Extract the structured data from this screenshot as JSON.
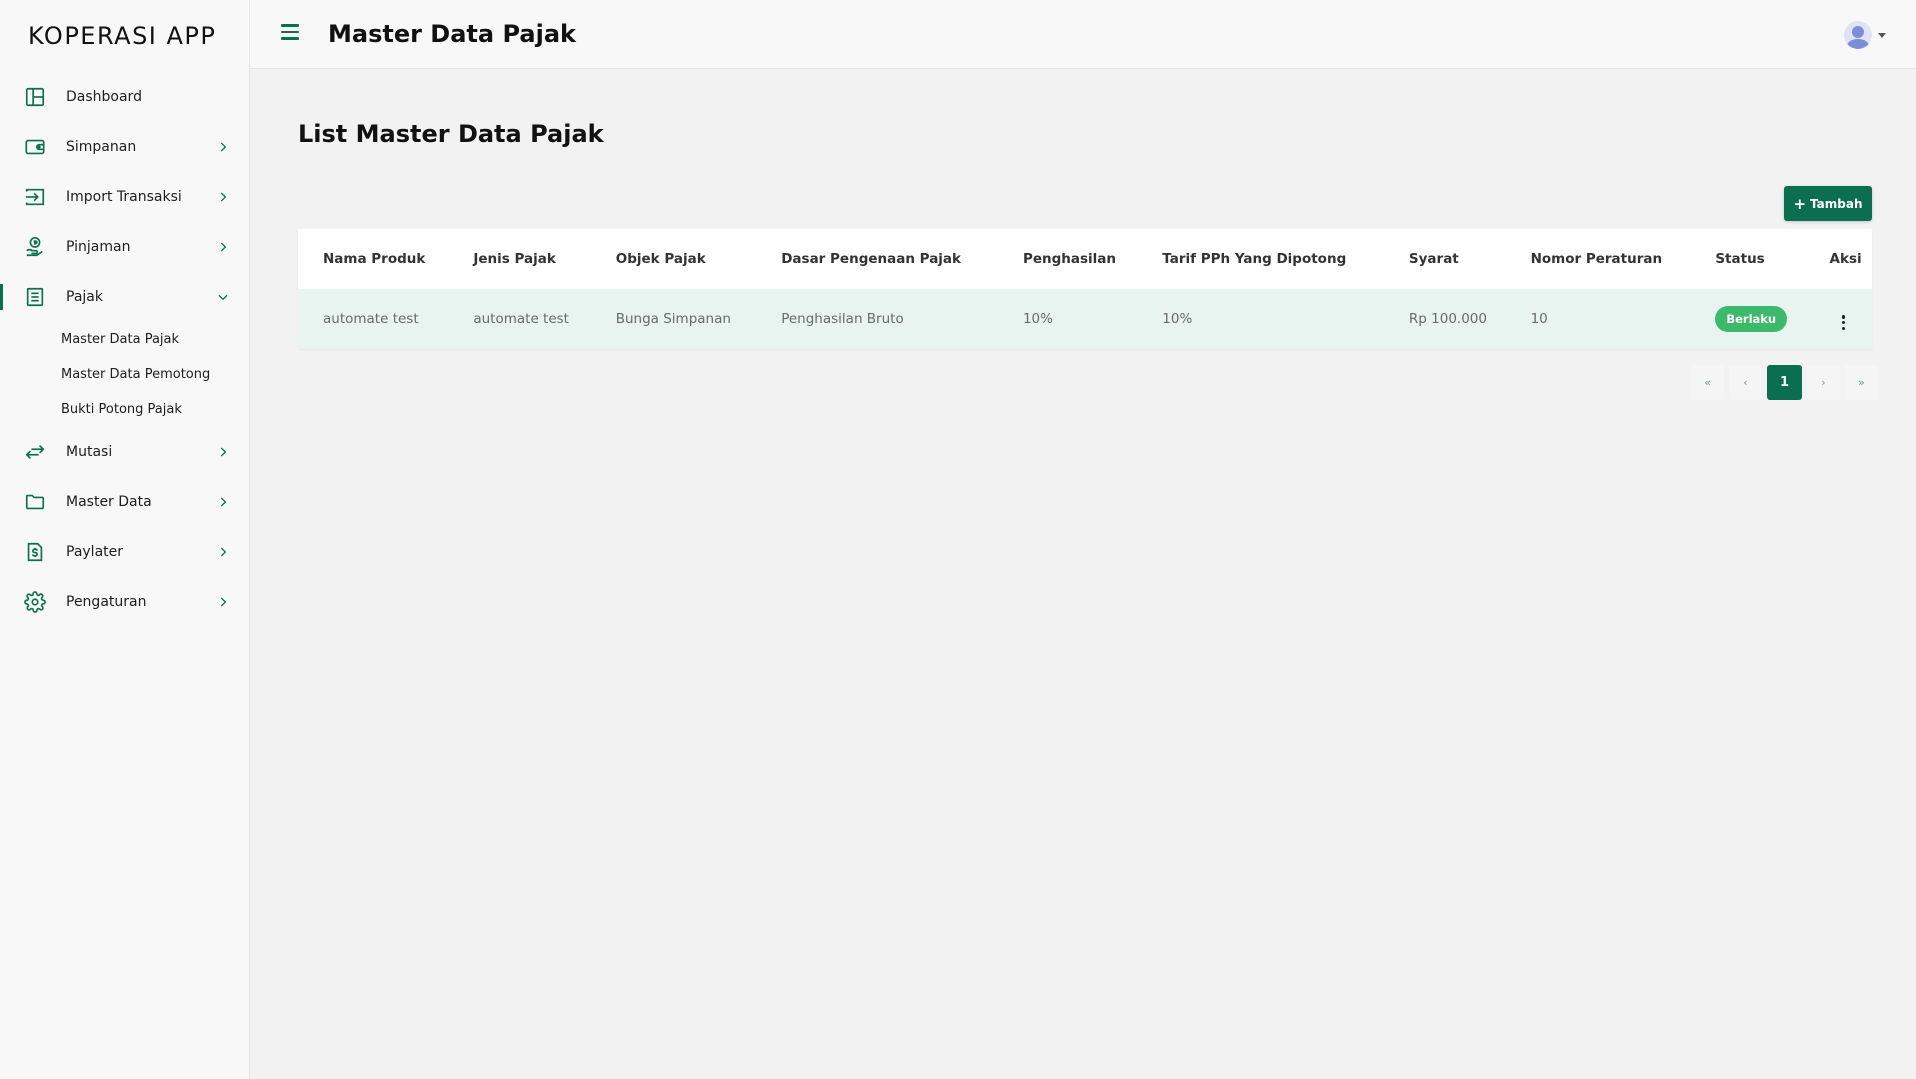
{
  "app": {
    "brand": "KOPERASI APP"
  },
  "header": {
    "title": "Master Data Pajak"
  },
  "sidebar": {
    "items": [
      {
        "label": "Dashboard",
        "icon": "layout-icon",
        "has_chevron": false
      },
      {
        "label": "Simpanan",
        "icon": "wallet-icon",
        "has_chevron": true
      },
      {
        "label": "Import Transaksi",
        "icon": "import-icon",
        "has_chevron": true
      },
      {
        "label": "Pinjaman",
        "icon": "hand-coin-icon",
        "has_chevron": true
      },
      {
        "label": "Pajak",
        "icon": "document-list-icon",
        "has_chevron": true,
        "expanded": true,
        "active": true
      },
      {
        "label": "Mutasi",
        "icon": "transfer-arrows-icon",
        "has_chevron": true
      },
      {
        "label": "Master Data",
        "icon": "folder-icon",
        "has_chevron": true
      },
      {
        "label": "Paylater",
        "icon": "dollar-file-icon",
        "has_chevron": true
      },
      {
        "label": "Pengaturan",
        "icon": "gear-icon",
        "has_chevron": true
      }
    ],
    "pajak_sub": [
      "Master Data Pajak",
      "Master Data Pemotong",
      "Bukti Potong Pajak"
    ]
  },
  "main": {
    "title": "List Master Data Pajak",
    "add_button": "Tambah",
    "table": {
      "columns": [
        "Nama Produk",
        "Jenis Pajak",
        "Objek Pajak",
        "Dasar Pengenaan Pajak",
        "Penghasilan",
        "Tarif PPh Yang Dipotong",
        "Syarat",
        "Nomor Peraturan",
        "Status",
        "Aksi"
      ],
      "rows": [
        {
          "nama_produk": "automate test",
          "jenis_pajak": "automate test",
          "objek_pajak": "Bunga Simpanan",
          "dasar_pengenaan": "Penghasilan Bruto",
          "penghasilan": "10%",
          "tarif": "10%",
          "syarat": "Rp 100.000",
          "nomor_peraturan": "10",
          "status": "Berlaku"
        }
      ]
    },
    "pagination": {
      "first": "«",
      "prev": "‹",
      "current": "1",
      "next": "›",
      "last": "»"
    }
  },
  "colors": {
    "primary": "#0b6e4f",
    "status_active": "#3cb96a",
    "row_highlight": "#e8f4ef"
  }
}
